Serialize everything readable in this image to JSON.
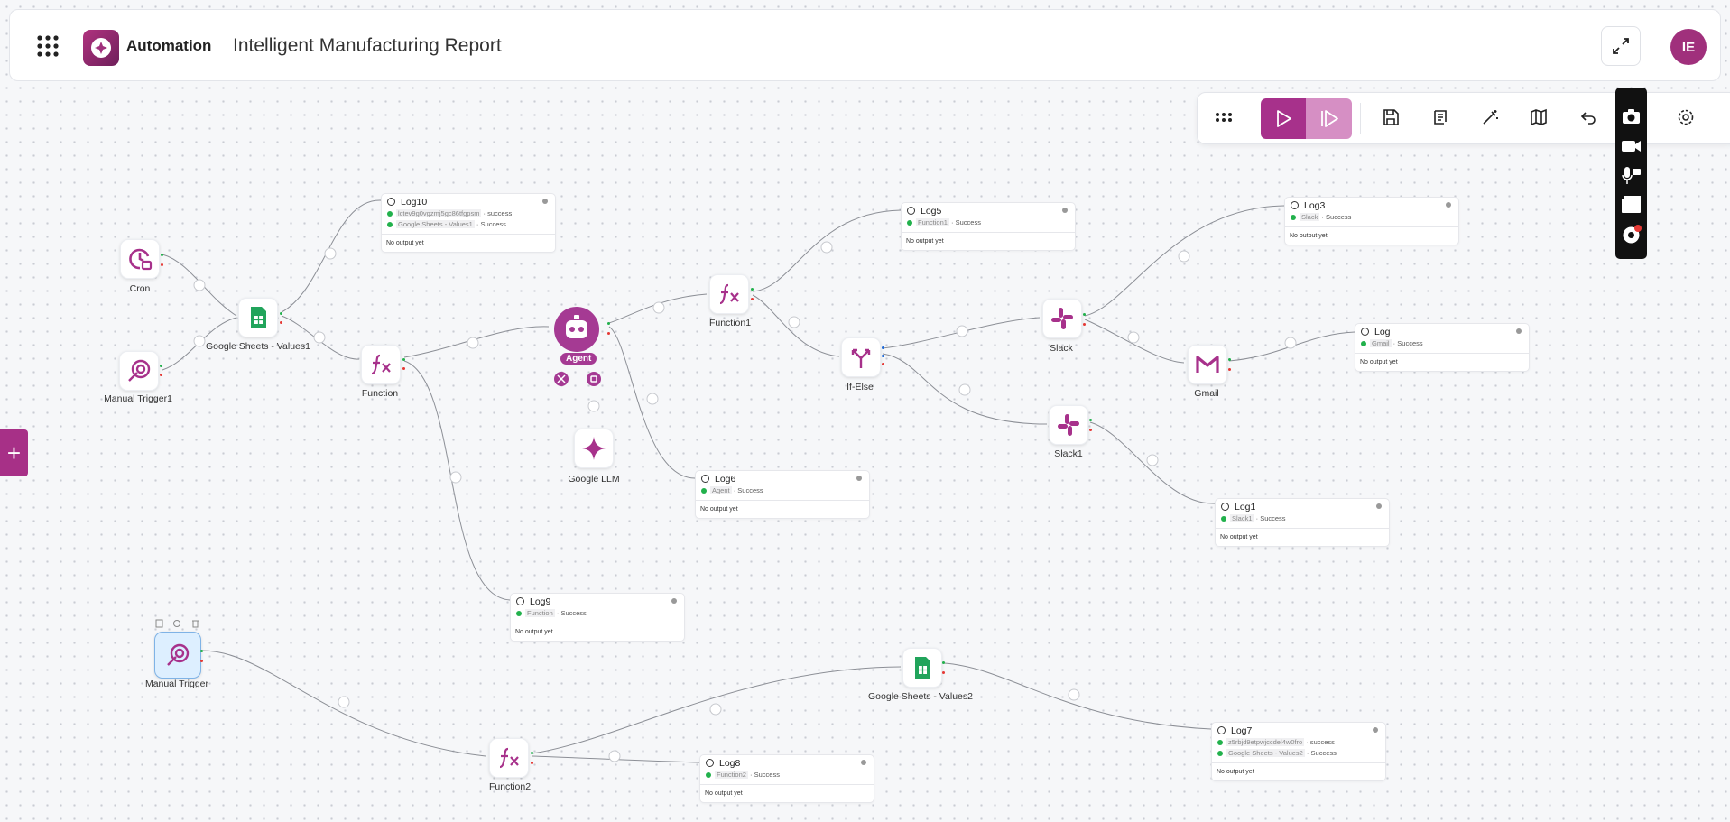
{
  "header": {
    "app_name": "Automation",
    "page_title": "Intelligent Manufacturing Report",
    "avatar_initials": "IE"
  },
  "side": {
    "add_label": "+"
  },
  "nodes": {
    "cron": "Cron",
    "manual_trigger1": "Manual Trigger1",
    "google_sheets_values1": "Google Sheets - Values1",
    "function": "Function",
    "agent": "Agent",
    "google_llm": "Google LLM",
    "function1": "Function1",
    "if_else": "If-Else",
    "slack": "Slack",
    "slack1": "Slack1",
    "gmail": "Gmail",
    "manual_trigger": "Manual Trigger",
    "function2": "Function2",
    "google_sheets_values2": "Google Sheets - Values2"
  },
  "logs": {
    "log10": {
      "title": "Log10",
      "rows": [
        {
          "src": "lctev9g0vgzmj5gc86tfgpsm",
          "status": "success"
        },
        {
          "src": "Google Sheets - Values1",
          "status": "Success"
        }
      ],
      "output": "No output yet"
    },
    "log5": {
      "title": "Log5",
      "rows": [
        {
          "src": "Function1",
          "status": "Success"
        }
      ],
      "output": "No output yet"
    },
    "log3": {
      "title": "Log3",
      "rows": [
        {
          "src": "Slack",
          "status": "Success"
        }
      ],
      "output": "No output yet"
    },
    "log": {
      "title": "Log",
      "rows": [
        {
          "src": "Gmail",
          "status": "Success"
        }
      ],
      "output": "No output yet"
    },
    "log6": {
      "title": "Log6",
      "rows": [
        {
          "src": "Agent",
          "status": "Success"
        }
      ],
      "output": "No output yet"
    },
    "log1": {
      "title": "Log1",
      "rows": [
        {
          "src": "Slack1",
          "status": "Success"
        }
      ],
      "output": "No output yet"
    },
    "log9": {
      "title": "Log9",
      "rows": [
        {
          "src": "Function",
          "status": "Success"
        }
      ],
      "output": "No output yet"
    },
    "log7": {
      "title": "Log7",
      "rows": [
        {
          "src": "z5rbjd9etpwjccdel4w0fro",
          "status": "success"
        },
        {
          "src": "Google Sheets - Values2",
          "status": "Success"
        }
      ],
      "output": "No output yet"
    },
    "log8": {
      "title": "Log8",
      "rows": [
        {
          "src": "Function2",
          "status": "Success"
        }
      ],
      "output": "No output yet"
    }
  },
  "colors": {
    "accent": "#a7318b",
    "success": "#22b14c",
    "sheets": "#21a45b"
  },
  "icons": [
    "apps-grid-icon",
    "play-icon",
    "step-play-icon",
    "save-icon",
    "script-icon",
    "magic-wand-icon",
    "map-icon",
    "undo-icon",
    "settings-icon",
    "camera-icon",
    "video-icon",
    "mic-icon",
    "window-icon",
    "gear-icon",
    "expand-icon"
  ]
}
